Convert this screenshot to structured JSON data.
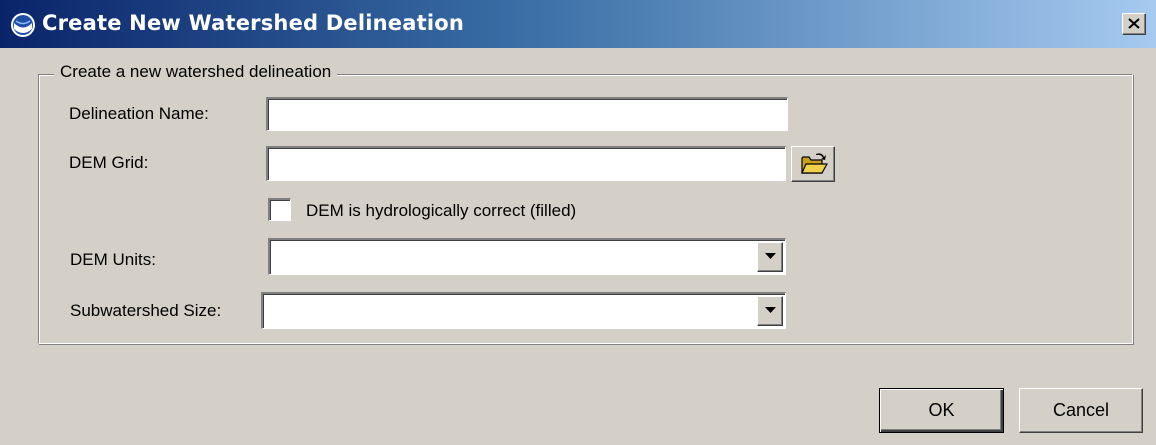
{
  "window": {
    "title": "Create New Watershed Delineation",
    "close_symbol": "×"
  },
  "group": {
    "legend": "Create a new watershed delineation"
  },
  "fields": {
    "delineation_name": {
      "label": "Delineation Name:",
      "value": ""
    },
    "dem_grid": {
      "label": "DEM Grid:",
      "value": ""
    },
    "dem_filled": {
      "label": "DEM is hydrologically correct (filled)",
      "checked": false
    },
    "dem_units": {
      "label": "DEM Units:",
      "selected": ""
    },
    "subwatershed_size": {
      "label": "Subwatershed Size:",
      "selected": ""
    }
  },
  "buttons": {
    "ok": "OK",
    "cancel": "Cancel"
  },
  "icons": {
    "app": "noaa-logo-icon",
    "browse": "open-folder-icon",
    "dropdown": "dropdown-arrow-icon",
    "close": "close-icon"
  },
  "colors": {
    "title_bar_start": "#0a246a",
    "title_bar_end": "#a6caf0",
    "dialog_face": "#d4d0c8"
  }
}
